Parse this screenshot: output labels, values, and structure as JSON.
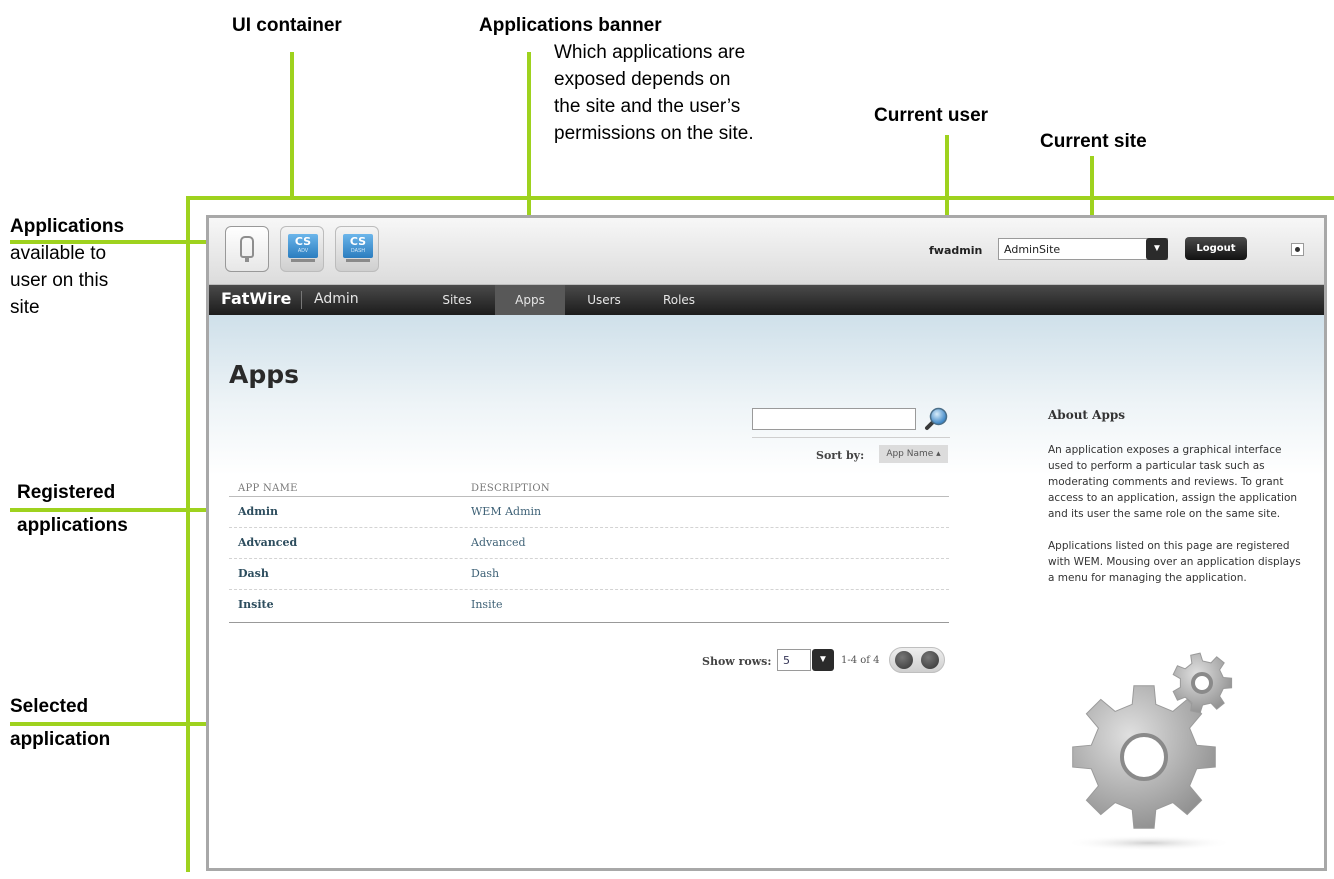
{
  "annotations": {
    "ui_container": "UI container",
    "apps_banner_title": "Applications banner",
    "apps_banner_desc": [
      "Which applications are",
      "exposed depends on",
      "the site and the user’s",
      "permissions on the site."
    ],
    "current_user": "Current user",
    "current_site": "Current site",
    "apps_available_title": "Applications",
    "apps_available_desc": [
      "available to",
      "user on this",
      "site"
    ],
    "registered_line1": "Registered",
    "registered_line2": "applications",
    "selected_line1": "Selected",
    "selected_line2": "application"
  },
  "banner": {
    "app_icons": [
      {
        "name": "bulb-icon",
        "label": "",
        "sub": ""
      },
      {
        "name": "cs-adv-icon",
        "label": "CS",
        "sub": "ADV"
      },
      {
        "name": "cs-dash-icon",
        "label": "CS",
        "sub": "DASH"
      }
    ],
    "user": "fwadmin",
    "site": "AdminSite",
    "logout": "Logout"
  },
  "nav": {
    "brand": "FatWire",
    "section": "Admin",
    "items": [
      "Sites",
      "Apps",
      "Users",
      "Roles"
    ],
    "active": "Apps"
  },
  "page": {
    "title": "Apps",
    "search_placeholder": "",
    "sort_label": "Sort by:",
    "sort_value": "App Name ▴",
    "columns": [
      "APP NAME",
      "DESCRIPTION"
    ],
    "rows": [
      {
        "name": "Admin",
        "description": "WEM Admin"
      },
      {
        "name": "Advanced",
        "description": "Advanced"
      },
      {
        "name": "Dash",
        "description": "Dash"
      },
      {
        "name": "Insite",
        "description": "Insite"
      }
    ],
    "show_rows_label": "Show rows:",
    "show_rows_value": "5",
    "page_count": "1-4 of 4"
  },
  "about": {
    "title": "About Apps",
    "para1": "An application exposes a graphical interface used to perform a particular task such as moderating comments and reviews. To grant access to an application, assign the application and its user the same role on the same site.",
    "para2": "Applications listed on this page are registered with WEM. Mousing over an application displays a menu for managing the application."
  },
  "colors": {
    "callout_line": "#9ed21e",
    "nav_bg": "#2a2a2a",
    "frame_border": "#a8a8a8"
  }
}
